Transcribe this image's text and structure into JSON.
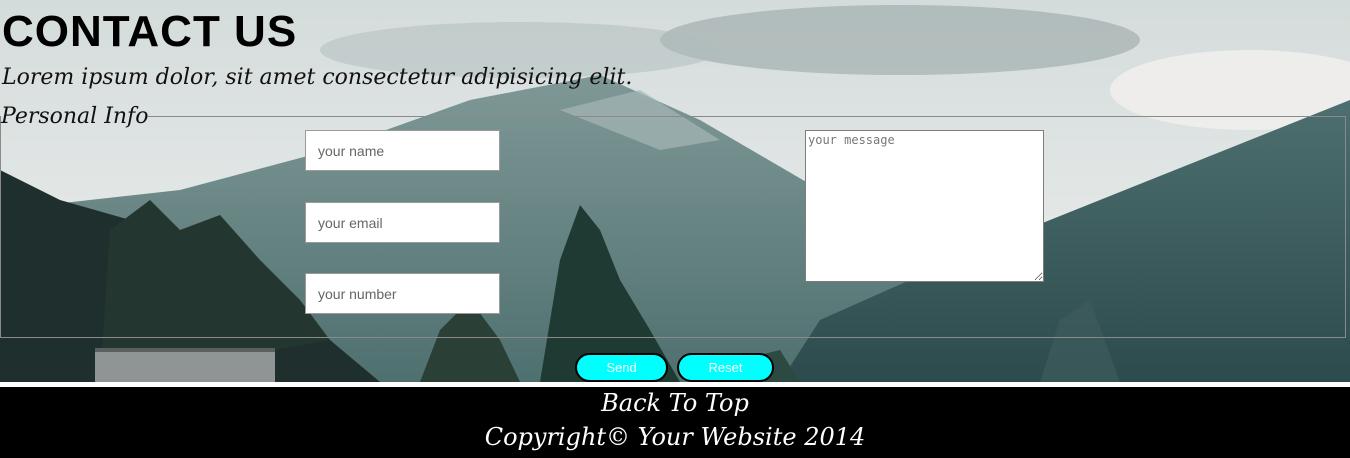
{
  "header": {
    "title": "CONTACT US",
    "subtitle": "Lorem ipsum dolor, sit amet consectetur adipisicing elit."
  },
  "form": {
    "legend": "Personal Info",
    "name_placeholder": "your name",
    "email_placeholder": "your email",
    "number_placeholder": "your number",
    "message_placeholder": "your message",
    "send_label": "Send",
    "reset_label": "Reset"
  },
  "footer": {
    "back_to_top": "Back To Top",
    "copyright": "Copyright© Your Website 2014"
  },
  "colors": {
    "button_fill": "#00ffff",
    "footer_bg": "#000000"
  },
  "background": {
    "icon": "mountain-landscape-photo"
  }
}
